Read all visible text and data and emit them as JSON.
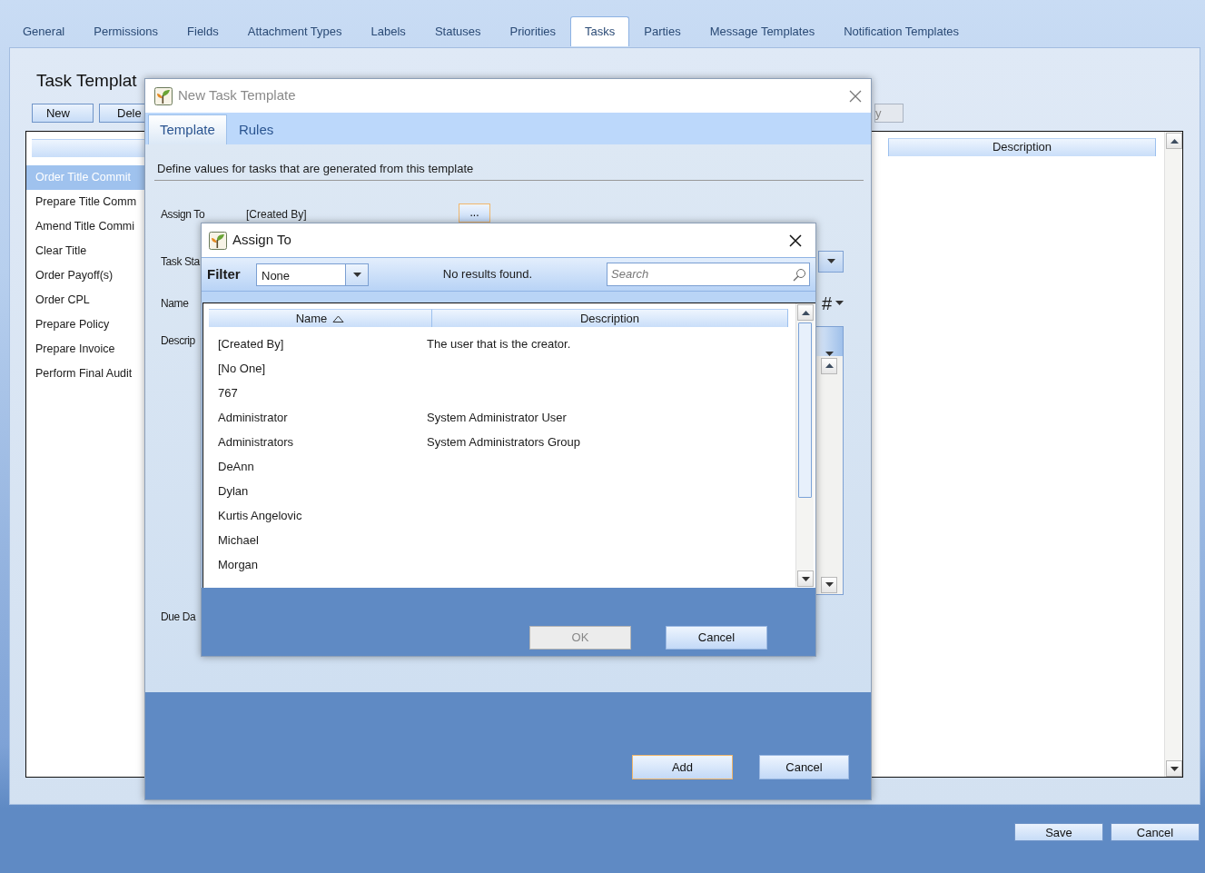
{
  "tabs": [
    {
      "label": "General",
      "selected": false
    },
    {
      "label": "Permissions",
      "selected": false
    },
    {
      "label": "Fields",
      "selected": false
    },
    {
      "label": "Attachment Types",
      "selected": false
    },
    {
      "label": "Labels",
      "selected": false
    },
    {
      "label": "Statuses",
      "selected": false
    },
    {
      "label": "Priorities",
      "selected": false
    },
    {
      "label": "Tasks",
      "selected": true
    },
    {
      "label": "Parties",
      "selected": false
    },
    {
      "label": "Message Templates",
      "selected": false
    },
    {
      "label": "Notification Templates",
      "selected": false
    }
  ],
  "main": {
    "title": "Task Templat",
    "buttons": [
      "New",
      "Dele"
    ],
    "right_button": "y",
    "templates": [
      {
        "label": "Order Title Commit",
        "selected": true
      },
      {
        "label": "Prepare Title Comm",
        "selected": false
      },
      {
        "label": "Amend Title Commi",
        "selected": false
      },
      {
        "label": "Clear Title",
        "selected": false
      },
      {
        "label": "Order Payoff(s)",
        "selected": false
      },
      {
        "label": "Order CPL",
        "selected": false
      },
      {
        "label": "Prepare Policy",
        "selected": false
      },
      {
        "label": "Prepare Invoice",
        "selected": false
      },
      {
        "label": "Perform Final Audit",
        "selected": false
      }
    ],
    "list_column": "Description"
  },
  "footer_buttons": [
    "Save",
    "Cancel"
  ],
  "task_dialog": {
    "title": "New Task Template",
    "tabs": [
      {
        "label": "Template",
        "selected": true
      },
      {
        "label": "Rules",
        "selected": false
      }
    ],
    "intro": "Define values for tasks that are generated from this template",
    "assign_label": "Assign To",
    "assign_value": "[Created By]",
    "browse_button": "...",
    "field_labels": [
      "Task Sta",
      "Name",
      "Descrip",
      "Due Da"
    ],
    "number_symbol": "#",
    "buttons": [
      {
        "label": "Add",
        "default": true
      },
      {
        "label": "Cancel",
        "default": false
      }
    ]
  },
  "assign_dialog": {
    "title": "Assign To",
    "filter_label": "Filter",
    "filter_value": "None",
    "status": "No results found.",
    "search": {
      "placeholder": "Search"
    },
    "columns": [
      {
        "label": "Name",
        "sorted": true
      },
      {
        "label": "Description",
        "sorted": false
      }
    ],
    "rows": [
      {
        "name": "[Created By]",
        "description": "The user that is the creator."
      },
      {
        "name": "[No One]"
      },
      {
        "name": "767"
      },
      {
        "name": "Administrator",
        "description": "System Administrator User"
      },
      {
        "name": "Administrators",
        "description": "System Administrators Group"
      },
      {
        "name": "DeAnn"
      },
      {
        "name": "Dylan"
      },
      {
        "name": "Kurtis Angelovic"
      },
      {
        "name": "Michael"
      },
      {
        "name": "Morgan"
      }
    ],
    "buttons": [
      {
        "label": "OK",
        "disabled": true
      },
      {
        "label": "Cancel",
        "disabled": false
      }
    ]
  }
}
